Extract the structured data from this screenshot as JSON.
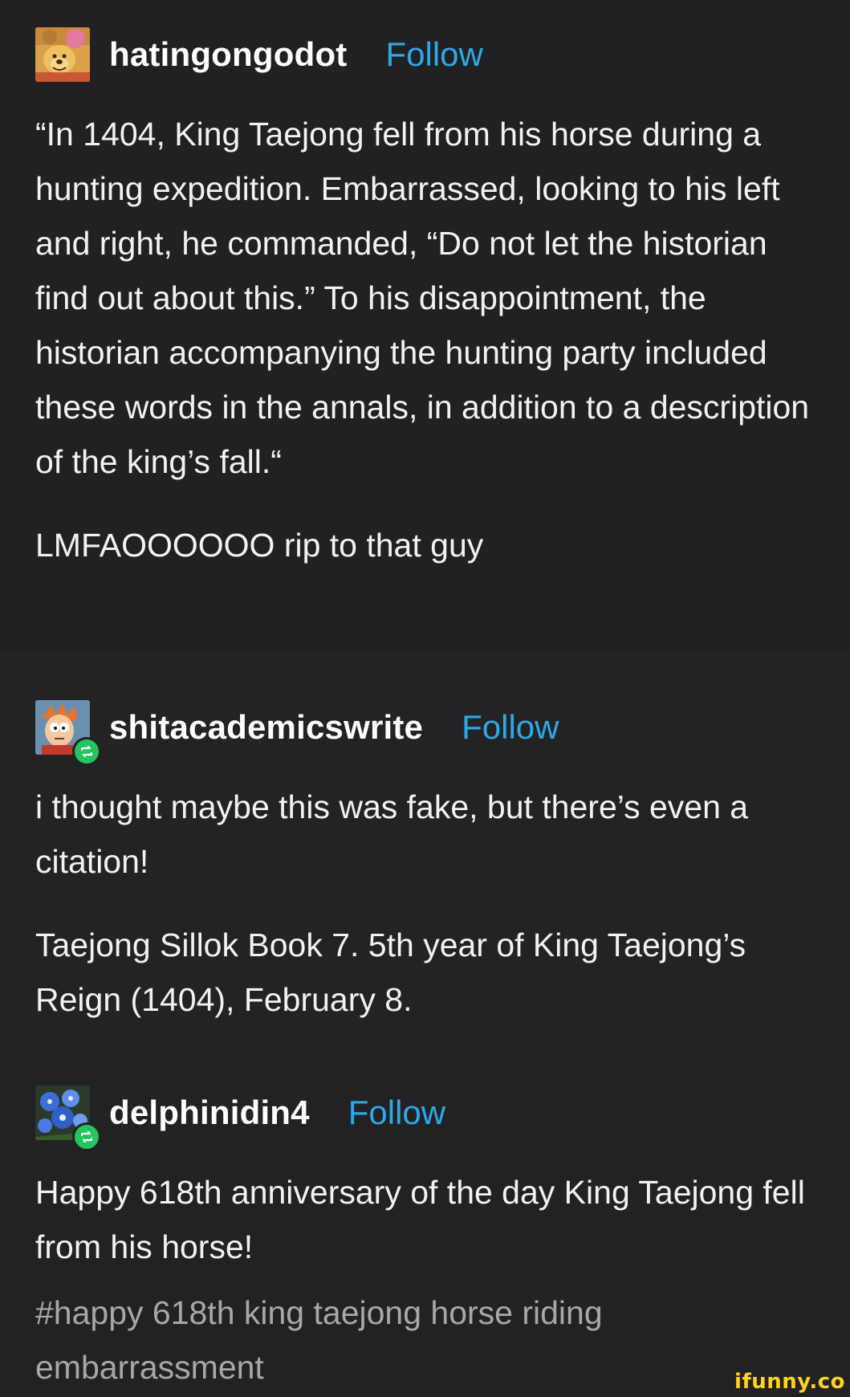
{
  "posts": [
    {
      "username": "hatingongodot",
      "follow_label": "Follow",
      "avatar_icon": "winnie-the-pooh-avatar",
      "reblogged": false,
      "paragraphs": [
        "“In 1404, King Taejong fell from his horse during a hunting expedition. Embarrassed, looking to his left and right, he commanded, “Do not let the historian find out about this.” To his disappointment, the historian accompanying the hunting party included these words in the annals, in addition to a description of the king’s fall.“",
        "LMFAOOOOOO rip to that guy"
      ]
    },
    {
      "username": "shitacademicswrite",
      "follow_label": "Follow",
      "avatar_icon": "fry-cartoon-avatar",
      "reblogged": true,
      "paragraphs": [
        "i thought maybe this was fake, but there’s even a citation!",
        "Taejong Sillok Book 7. 5th year of King Taejong’s Reign (1404), February 8."
      ]
    },
    {
      "username": "delphinidin4",
      "follow_label": "Follow",
      "avatar_icon": "blue-flowers-avatar",
      "reblogged": true,
      "paragraphs": [
        "Happy 618th anniversary of the day King Taejong fell from his horse!"
      ],
      "tags": "#happy 618th king taejong horse riding embarrassment"
    }
  ],
  "watermark": "ifunny.co",
  "colors": {
    "background": "#1f1f21",
    "text": "#f2f2f2",
    "follow": "#2fa8e6",
    "tag": "#a8a8aa",
    "reblog_badge": "#22c55e",
    "watermark": "#ffd21f"
  }
}
